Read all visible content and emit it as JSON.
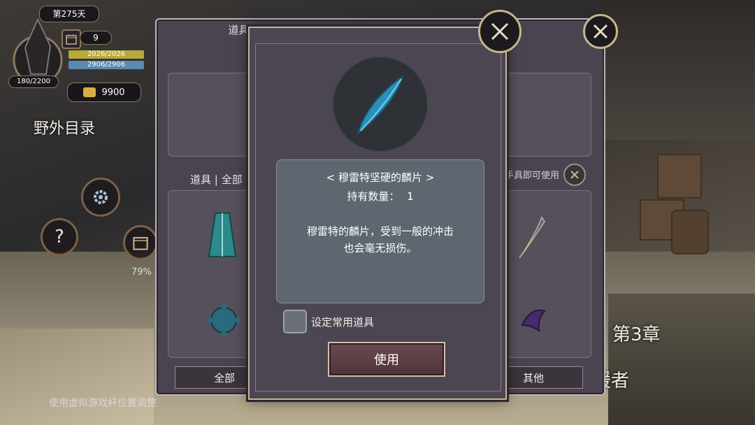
{
  "hud": {
    "day": "第275天",
    "calendar_count": "9",
    "hp": "2026/2026",
    "mp": "2906/2906",
    "exp": "180/2200",
    "gold": "9900",
    "percent": "79%"
  },
  "field_label": "野外目录",
  "chapter": "第3章",
  "helper_text": "援者",
  "hint": "使用虚拟游戏杆位置调整",
  "back_panel": {
    "title": "道具保管箱",
    "filter_label": "道具 | 全部",
    "right_hint": "手具即可使用",
    "tab_all": "全部",
    "tab_other": "其他"
  },
  "item_modal": {
    "name": "< 穆雷特坚硬的麟片 >",
    "quantity_label": "持有数量：",
    "quantity": "1",
    "description": "穆雷特的麟片，受到一般的冲击也会毫无损伤。",
    "checkbox_label": "设定常用道具",
    "use_button": "使用"
  },
  "colors": {
    "accent_gold": "#c9b48a",
    "hp_bar": "#b8a840",
    "mp_bar": "#5a8ab0",
    "scale_blue": "#2a90b8"
  },
  "icons": [
    "calendar-icon",
    "gold-icon",
    "gear-icon",
    "question-icon",
    "close-icon",
    "scale-icon",
    "robe-icon",
    "spiked-ball-icon",
    "blade-icon",
    "claw-icon"
  ]
}
